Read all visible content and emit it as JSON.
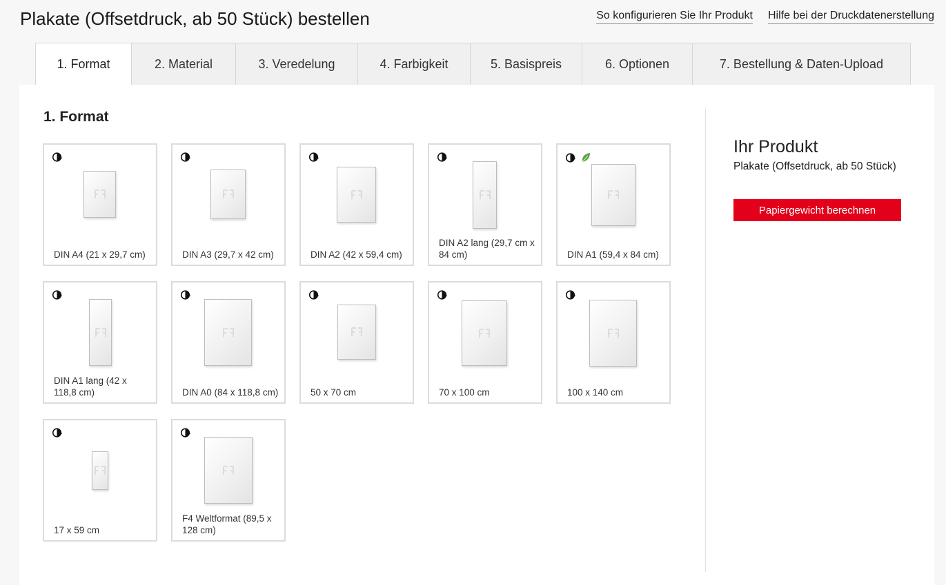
{
  "header": {
    "title": "Plakate (Offsetdruck, ab 50 Stück) bestellen",
    "links": [
      "So konfigurieren Sie Ihr Produkt",
      "Hilfe bei der Druckdatenerstellung"
    ]
  },
  "tabs": [
    "1. Format",
    "2. Material",
    "3. Veredelung",
    "4. Farbigkeit",
    "5. Basispreis",
    "6. Optionen",
    "7. Bestellung & Daten-Upload"
  ],
  "active_tab": 0,
  "main": {
    "section_title": "1. Format",
    "formats": [
      {
        "label": "DIN A4 (21 x 29,7 cm)",
        "eco": false
      },
      {
        "label": "DIN A3 (29,7 x 42 cm)",
        "eco": false
      },
      {
        "label": "DIN A2 (42 x 59,4 cm)",
        "eco": false
      },
      {
        "label": "DIN A2 lang (29,7 cm x 84 cm)",
        "eco": false
      },
      {
        "label": "DIN A1 (59,4 x 84 cm)",
        "eco": true
      },
      {
        "label": "DIN A1 lang (42 x 118,8 cm)",
        "eco": false
      },
      {
        "label": "DIN A0 (84 x 118,8 cm)",
        "eco": false
      },
      {
        "label": "50 x 70 cm",
        "eco": false
      },
      {
        "label": "70 x 100 cm",
        "eco": false
      },
      {
        "label": "100 x 140 cm",
        "eco": false
      },
      {
        "label": "17 x 59 cm",
        "eco": false
      },
      {
        "label": "F4 Weltformat (89,5 x 128 cm)",
        "eco": false
      }
    ]
  },
  "sidebar": {
    "title": "Ihr Produkt",
    "product": "Plakate (Offsetdruck, ab 50 Stück)",
    "button_label": "Papiergewicht berechnen"
  },
  "colors": {
    "accent": "#e3001b",
    "eco": "#5aa544"
  },
  "icons": {
    "clock": "clock-icon",
    "eco": "leaf-icon"
  }
}
